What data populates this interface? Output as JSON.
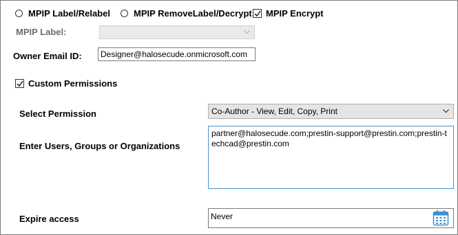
{
  "mode_options": [
    {
      "label": "MPIP Label/Relabel",
      "type": "radio",
      "selected": false
    },
    {
      "label": "MPIP RemoveLabel/Decrypt",
      "type": "radio",
      "selected": false
    },
    {
      "label": "MPIP Encrypt",
      "type": "checkbox",
      "checked": true
    }
  ],
  "mpip_label": {
    "label": "MPIP Label:",
    "value": "",
    "enabled": false
  },
  "owner_email": {
    "label": "Owner Email ID:",
    "value": "Designer@halosecude.onmicrosoft.com"
  },
  "custom_permissions": {
    "label": "Custom Permissions",
    "checked": true
  },
  "select_permission": {
    "label": "Select Permission",
    "value": "Co-Author - View, Edit, Copy, Print"
  },
  "users": {
    "label": "Enter Users, Groups or Organizations",
    "value": "partner@halosecude.com;prestin-support@prestin.com;prestin-techcad@prestin.com"
  },
  "expire": {
    "label": "Expire access",
    "value": "Never"
  },
  "icons": {
    "calendar": "calendar-icon",
    "dropdown": "chevron-down-icon",
    "checkmark": "checkmark-icon"
  },
  "colors": {
    "border": "#7a7a7a",
    "focus_border": "#4a8ec9",
    "combo_bg": "#e5e5e5",
    "calendar_blue": "#3c8fd6"
  }
}
